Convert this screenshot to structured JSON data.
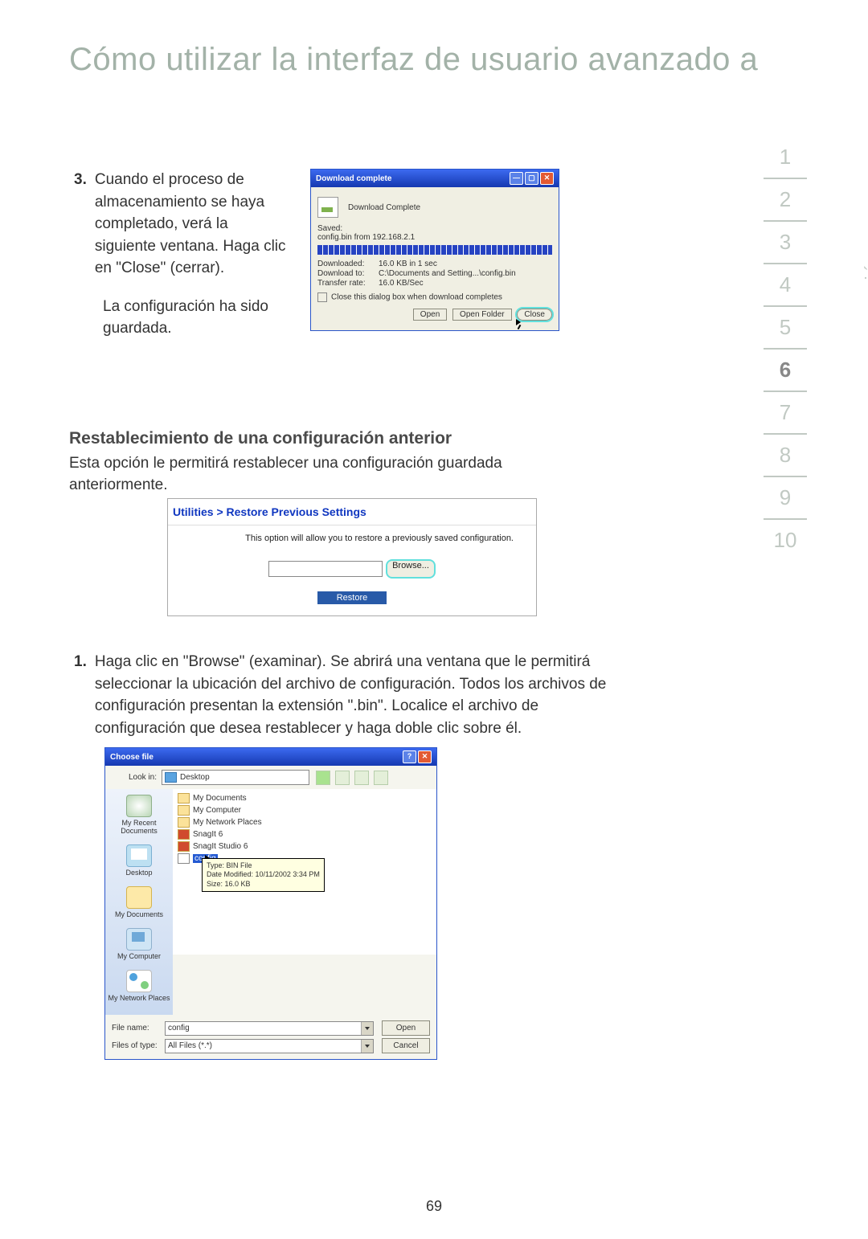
{
  "title": "Cómo utilizar la interfaz de usuario avanzado a",
  "sidebar": {
    "label": "sección",
    "items": [
      "1",
      "2",
      "3",
      "4",
      "5",
      "6",
      "7",
      "8",
      "9",
      "10"
    ],
    "active": 5
  },
  "step3": {
    "num": "3.",
    "p1": "Cuando el proceso de almacenamiento se haya completado, verá la siguiente ventana. Haga clic en \"Close\" (cerrar).",
    "p2": "La configuración ha sido guardada."
  },
  "dlg1": {
    "title": "Download complete",
    "heading": "Download Complete",
    "saved_label": "Saved:",
    "saved_value": "config.bin from 192.168.2.1",
    "downloaded": {
      "k": "Downloaded:",
      "v": "16.0 KB in 1 sec"
    },
    "downloadto": {
      "k": "Download to:",
      "v": "C:\\Documents and Setting...\\config.bin"
    },
    "rate": {
      "k": "Transfer rate:",
      "v": "16.0 KB/Sec"
    },
    "cb": "Close this dialog box when download completes",
    "open": "Open",
    "openf": "Open Folder",
    "close": "Close"
  },
  "h2": "Restablecimiento de una configuración anterior",
  "intro": "Esta opción le permitirá restablecer una configuración guardada anteriormente.",
  "panel": {
    "title": "Utilities > Restore Previous Settings",
    "desc": "This option will allow you to restore a previously saved configuration.",
    "browse": "Browse...",
    "restore": "Restore"
  },
  "step1": {
    "num": "1.",
    "p": "Haga clic en \"Browse\" (examinar). Se abrirá una ventana que le permitirá seleccionar la ubicación del archivo de configuración. Todos los archivos de configuración presentan la extensión \".bin\". Localice el archivo de configuración que desea restablecer y haga doble clic sobre él."
  },
  "dlg2": {
    "title": "Choose file",
    "lookin_label": "Look in:",
    "lookin_value": "Desktop",
    "places": {
      "recent": "My Recent Documents",
      "desktop": "Desktop",
      "docs": "My Documents",
      "comp": "My Computer",
      "net": "My Network Places"
    },
    "files": [
      "My Documents",
      "My Computer",
      "My Network Places",
      "SnagIt 6",
      "SnagIt Studio 6"
    ],
    "selected": "config",
    "tip": {
      "l1": "Type: BIN File",
      "l2": "Date Modified: 10/11/2002 3:34 PM",
      "l3": "Size: 16.0 KB"
    },
    "filename_label": "File name:",
    "filename_value": "config",
    "filetype_label": "Files of type:",
    "filetype_value": "All Files (*.*)",
    "open": "Open",
    "cancel": "Cancel"
  },
  "pagenum": "69"
}
